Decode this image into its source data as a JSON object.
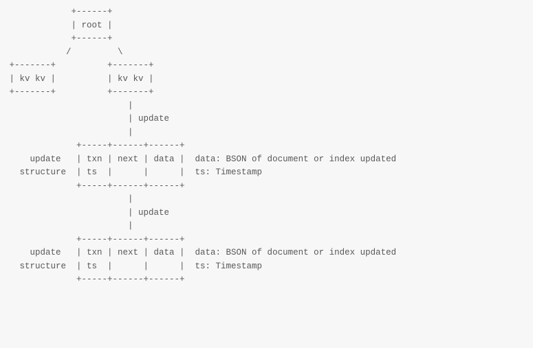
{
  "diagram": {
    "lines": [
      "             +------+",
      "             | root |",
      "             +------+",
      "            /         \\",
      " +-------+          +-------+",
      " | kv kv |          | kv kv |",
      " +-------+          +-------+",
      "                        |",
      "                        | update",
      "                        |",
      "              +-----+------+------+",
      "     update   | txn | next | data |  data: BSON of document or index updated",
      "   structure  | ts  |      |      |  ts: Timestamp",
      "              +-----+------+------+",
      "                        |",
      "                        | update",
      "                        |",
      "              +-----+------+------+",
      "     update   | txn | next | data |  data: BSON of document or index updated",
      "   structure  | ts  |      |      |  ts: Timestamp",
      "              +-----+------+------+"
    ]
  }
}
